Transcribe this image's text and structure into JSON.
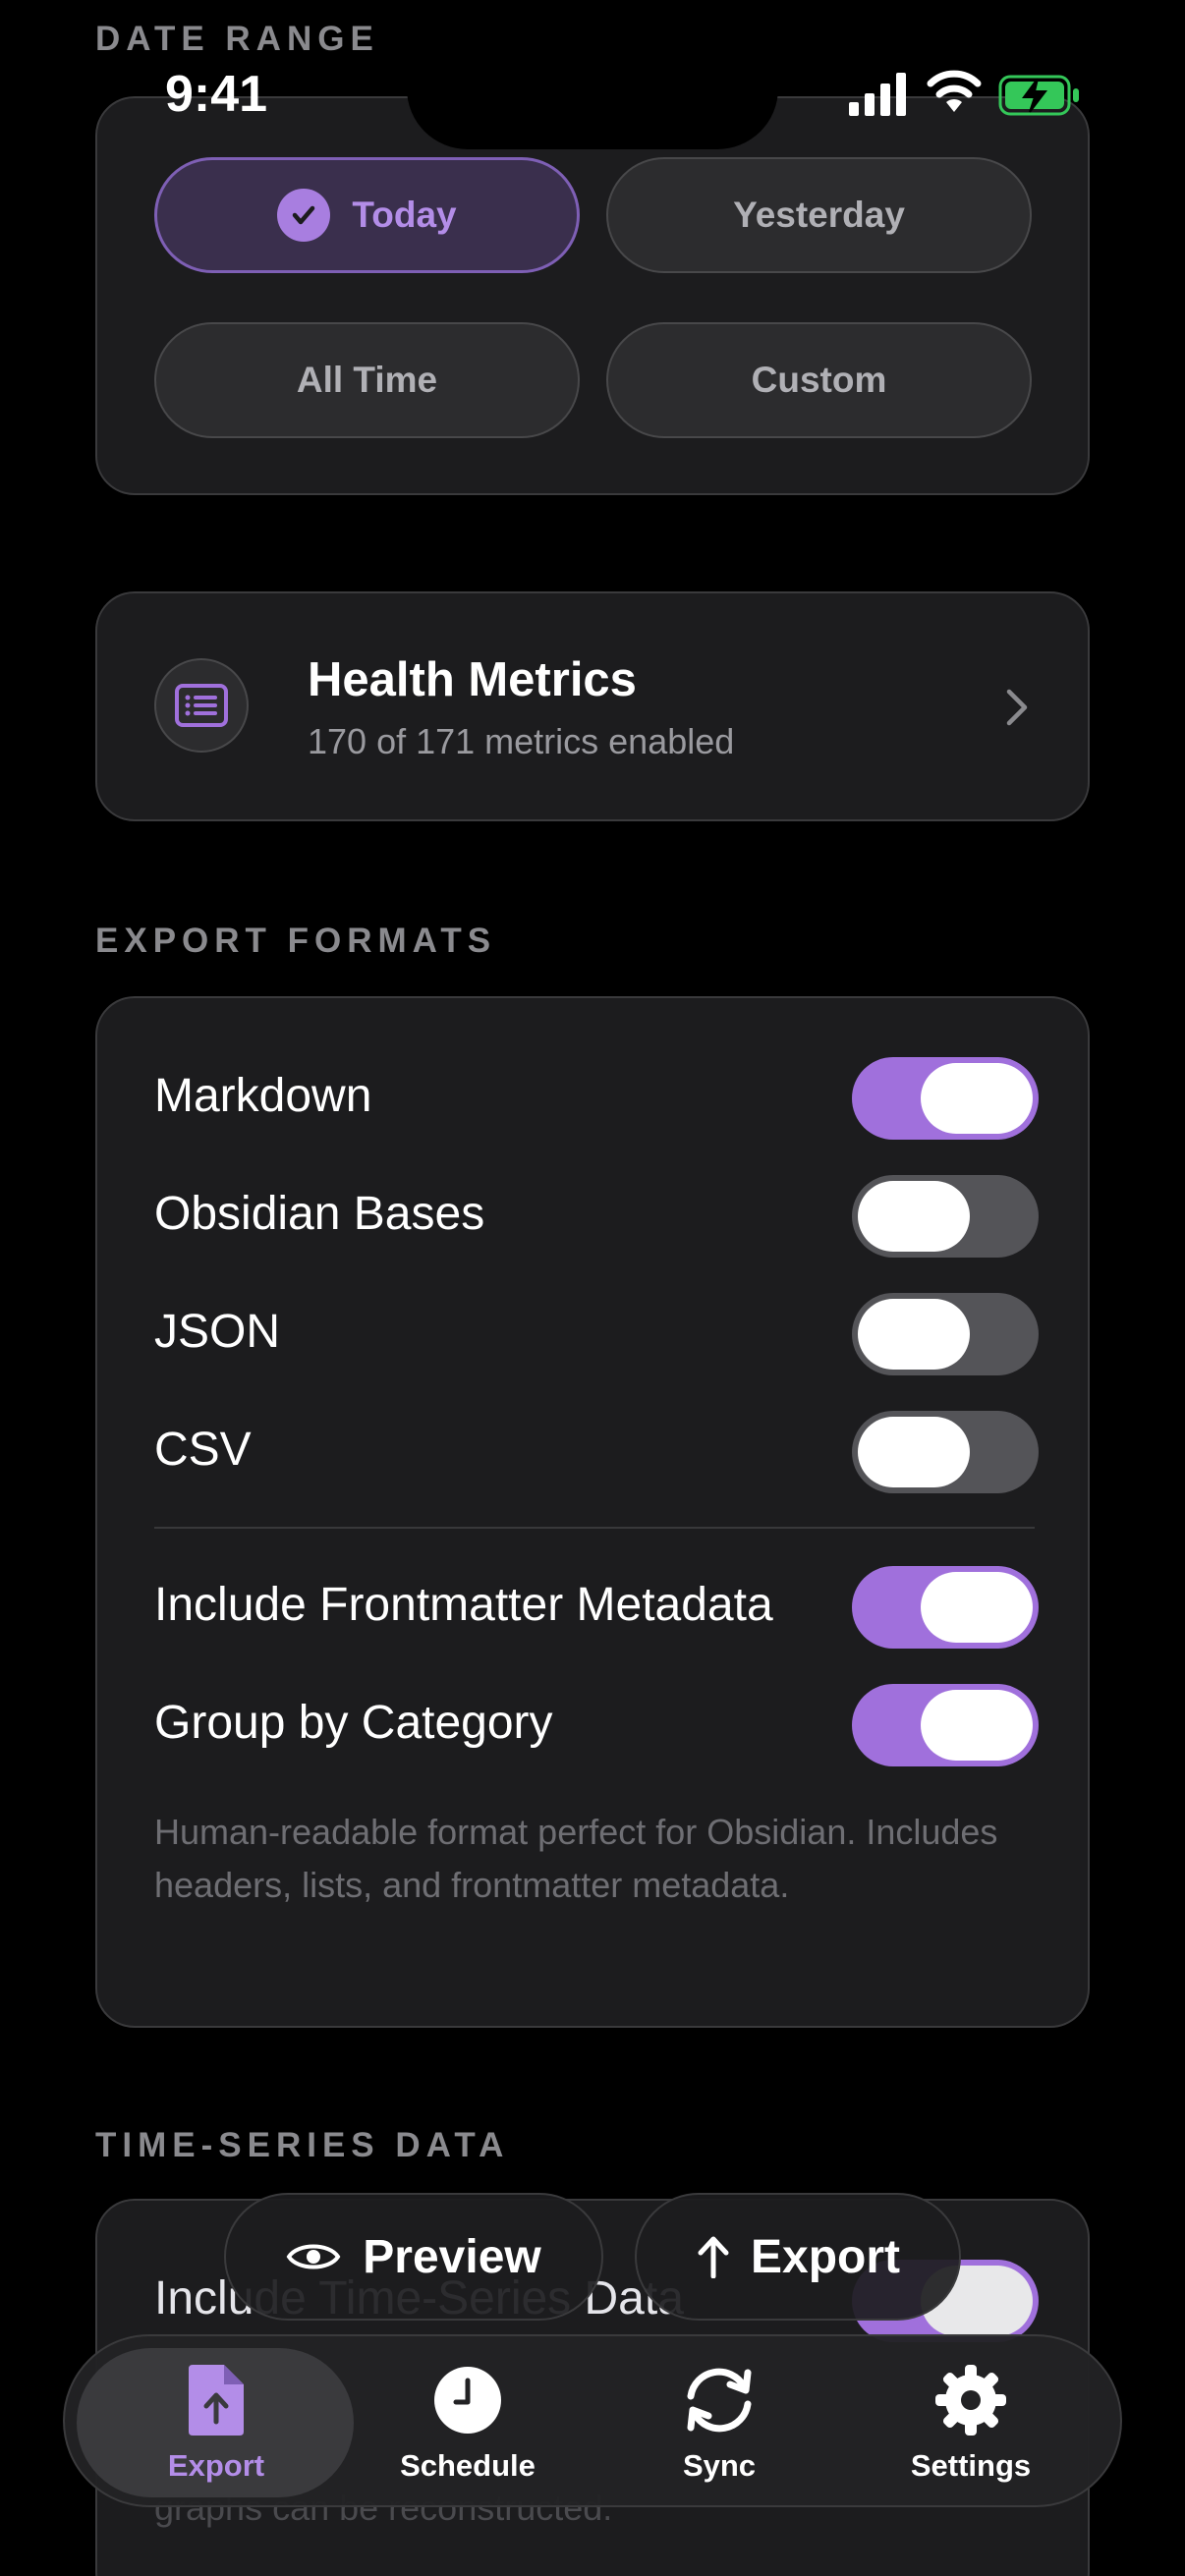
{
  "status_bar": {
    "time": "9:41"
  },
  "date_range": {
    "header": "DATE RANGE",
    "options": [
      {
        "label": "Today",
        "selected": true
      },
      {
        "label": "Yesterday",
        "selected": false
      },
      {
        "label": "All Time",
        "selected": false
      },
      {
        "label": "Custom",
        "selected": false
      }
    ]
  },
  "health_metrics": {
    "title": "Health Metrics",
    "subtitle": "170 of 171 metrics enabled"
  },
  "export_formats": {
    "header": "EXPORT FORMATS",
    "formats": [
      {
        "label": "Markdown",
        "on": true
      },
      {
        "label": "Obsidian Bases",
        "on": false
      },
      {
        "label": "JSON",
        "on": false
      },
      {
        "label": "CSV",
        "on": false
      }
    ],
    "options": [
      {
        "label": "Include Frontmatter Metadata",
        "on": true
      },
      {
        "label": "Group by Category",
        "on": true
      }
    ],
    "description": "Human-readable format perfect for Obsidian. Includes headers, lists, and frontmatter metadata."
  },
  "time_series": {
    "header": "TIME-SERIES DATA",
    "row_label": "Include Time-Series Data",
    "on": true,
    "description_fragment": "graphs can be reconstructed."
  },
  "actions": {
    "preview": "Preview",
    "export": "Export"
  },
  "tab_bar": {
    "tabs": [
      {
        "label": "Export",
        "icon": "doc-export-icon",
        "active": true
      },
      {
        "label": "Schedule",
        "icon": "clock-icon",
        "active": false
      },
      {
        "label": "Sync",
        "icon": "sync-icon",
        "active": false
      },
      {
        "label": "Settings",
        "icon": "gear-icon",
        "active": false
      }
    ]
  },
  "colors": {
    "accent": "#a070dc",
    "accent_text": "#b38de8",
    "background": "#000000",
    "card": "#1c1c1e",
    "battery": "#34c759"
  }
}
